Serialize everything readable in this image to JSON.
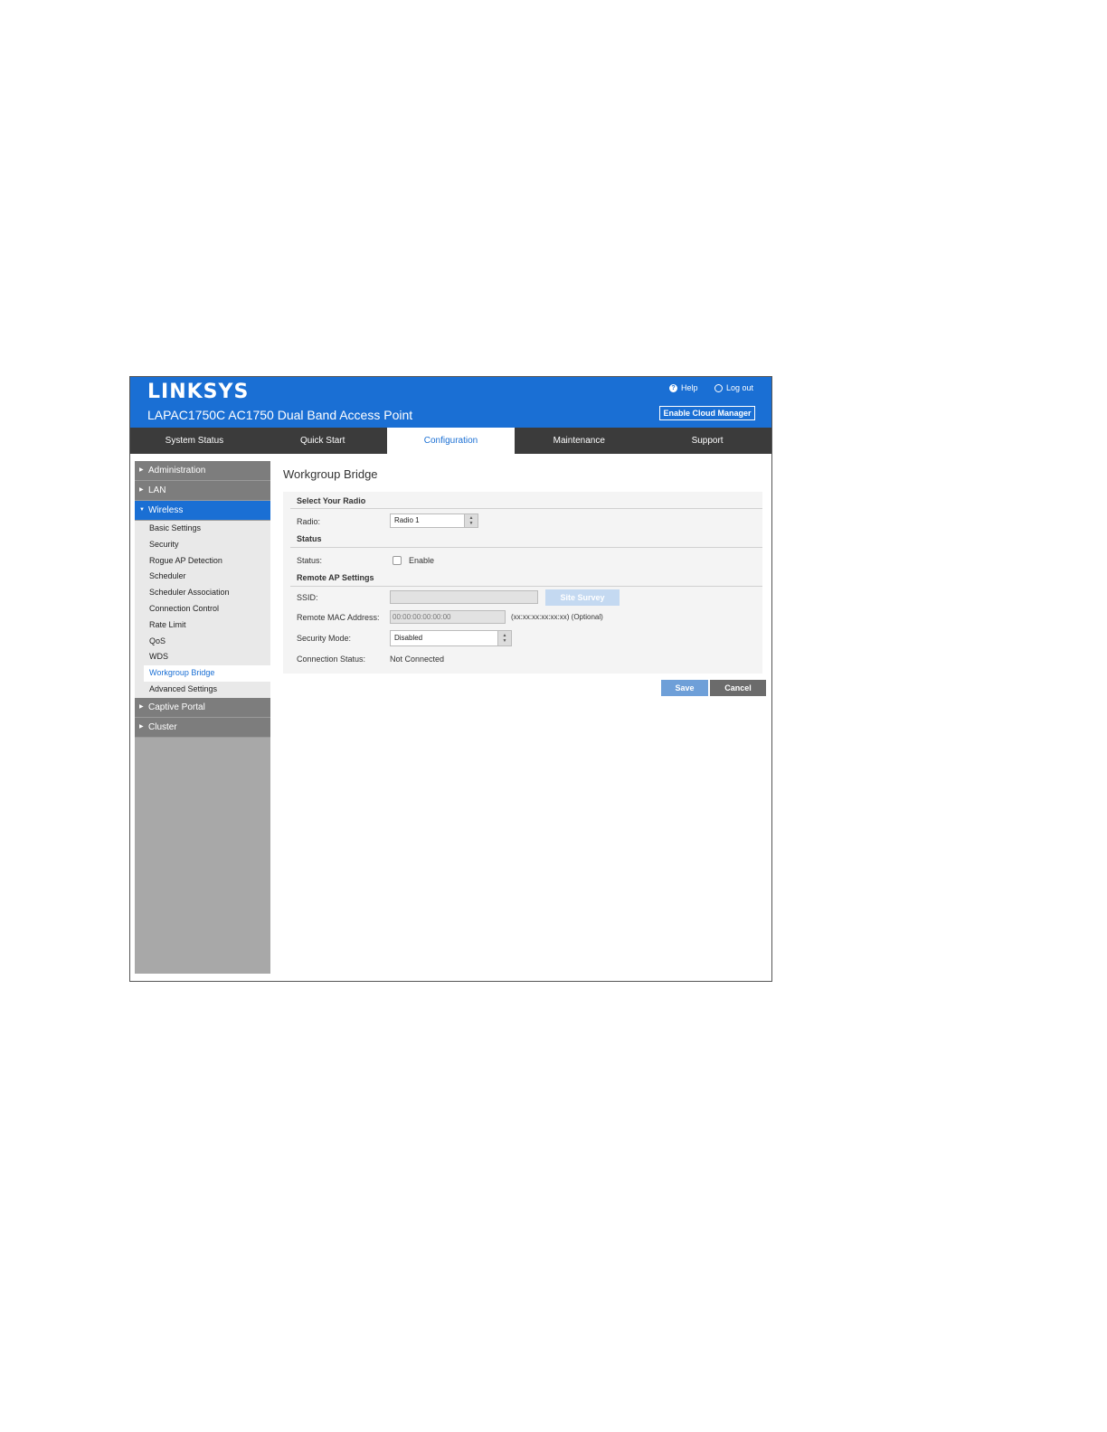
{
  "header": {
    "logo": "LINKSYS",
    "product_name": "LAPAC1750C AC1750 Dual Band Access Point",
    "help_label": "Help",
    "logout_label": "Log out",
    "cloud_button": "Enable Cloud Manager"
  },
  "tabs": [
    {
      "label": "System Status"
    },
    {
      "label": "Quick Start"
    },
    {
      "label": "Configuration"
    },
    {
      "label": "Maintenance"
    },
    {
      "label": "Support"
    }
  ],
  "sidebar": {
    "groups": [
      {
        "label": "Administration"
      },
      {
        "label": "LAN"
      },
      {
        "label": "Wireless"
      },
      {
        "label": "Captive Portal"
      },
      {
        "label": "Cluster"
      }
    ],
    "wireless_items": [
      {
        "label": "Basic Settings"
      },
      {
        "label": "Security"
      },
      {
        "label": "Rogue AP Detection"
      },
      {
        "label": "Scheduler"
      },
      {
        "label": "Scheduler Association"
      },
      {
        "label": "Connection Control"
      },
      {
        "label": "Rate Limit"
      },
      {
        "label": "QoS"
      },
      {
        "label": "WDS"
      },
      {
        "label": "Workgroup Bridge"
      },
      {
        "label": "Advanced Settings"
      }
    ]
  },
  "main": {
    "title": "Workgroup Bridge",
    "radio_section": {
      "heading": "Select Your Radio",
      "radio_label": "Radio:",
      "radio_value": "Radio 1"
    },
    "status_section": {
      "heading": "Status",
      "status_label": "Status:",
      "enable_label": "Enable"
    },
    "remote_section": {
      "heading": "Remote AP Settings",
      "ssid_label": "SSID:",
      "ssid_value": "",
      "site_survey_button": "Site Survey",
      "mac_label": "Remote MAC Address:",
      "mac_value": "00:00:00:00:00:00",
      "mac_hint": "(xx:xx:xx:xx:xx:xx) (Optional)",
      "security_label": "Security Mode:",
      "security_value": "Disabled",
      "conn_label": "Connection Status:",
      "conn_value": "Not Connected"
    },
    "save_button": "Save",
    "cancel_button": "Cancel"
  },
  "colors": {
    "brand_blue": "#1a6fd4",
    "tab_bar": "#3b3b3b",
    "sidebar_group": "#7d7d7d",
    "save_button": "#6e9fd8",
    "cancel_button": "#6b6b6b",
    "site_survey_button": "#c4d9f1"
  }
}
